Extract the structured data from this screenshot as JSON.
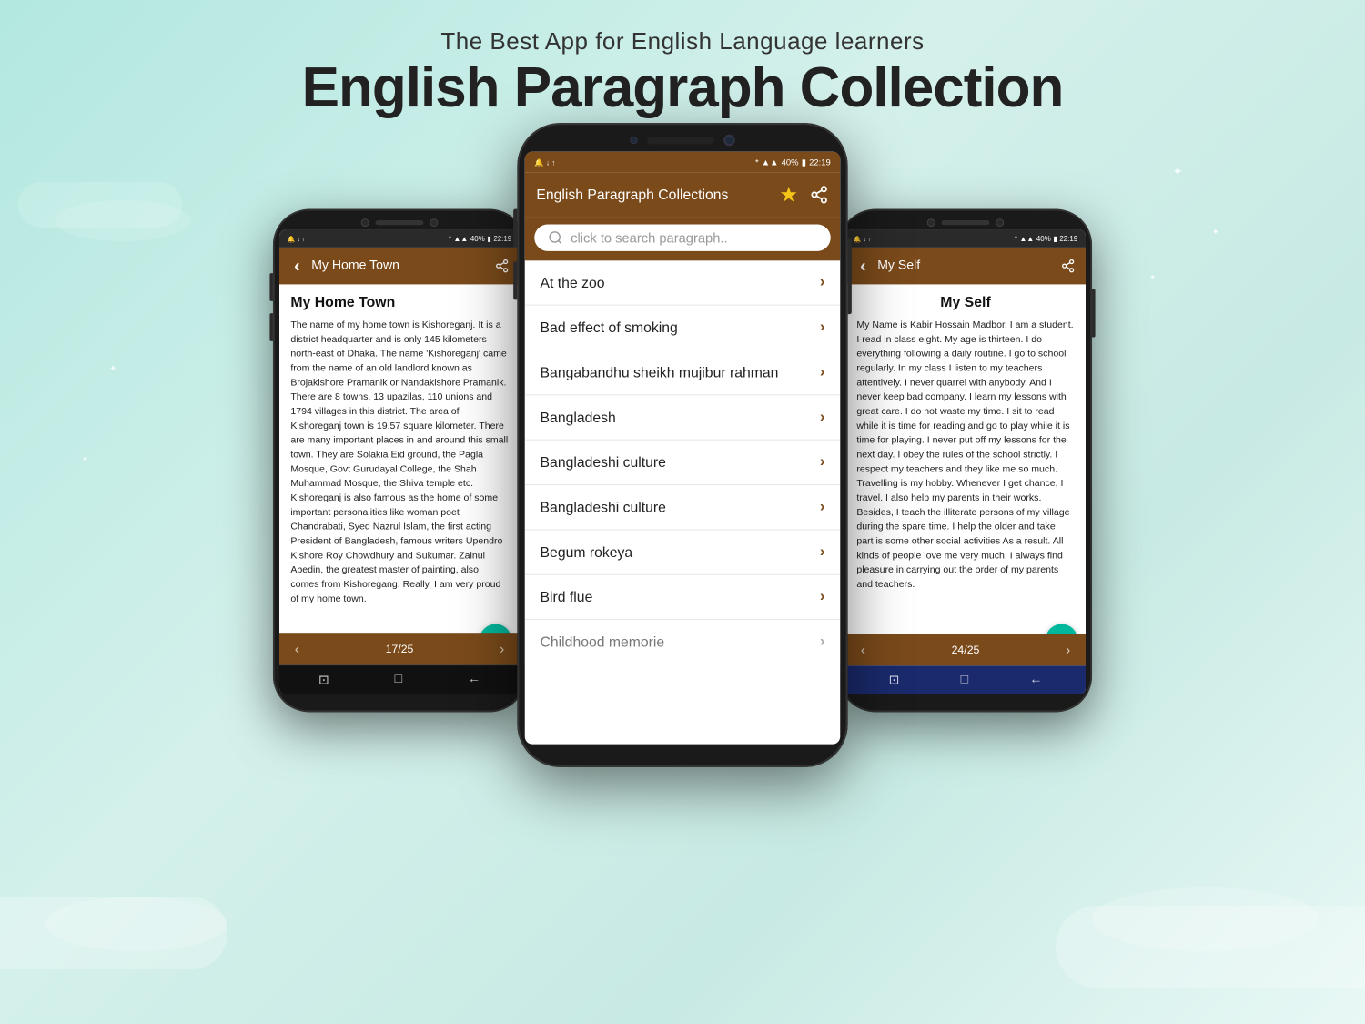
{
  "header": {
    "subtitle": "The Best App for English Language learners",
    "title": "English Paragraph Collection"
  },
  "phones": {
    "left": {
      "title": "My Home Town",
      "article_title": "My Home Town",
      "article_body": "The name of my home town is Kishoreganj. It is a district headquarter and is only 145 kilometers north-east of Dhaka. The name 'Kishoreganj' came from the name of an old landlord known as Brojakishore Pramanik or Nandakishore Pramanik. There are 8 towns, 13 upazilas, 110 unions and 1794 villages in this district. The area of Kishoreganj town is 19.57 square kilometer. There are many important places in and around this small town. They are Solakia Eid ground, the Pagla Mosque, Govt Gurudayal College, the Shah Muhammad Mosque, the Shiva temple etc. Kishoreganj is also famous as the home of some important personalities like woman poet Chandrabati, Syed Nazrul Islam, the first acting President of Bangladesh, famous writers Upendro Kishore Roy Chowdhury and Sukumar. Zainul Abedin, the greatest master of painting, also comes from Kishoregang. Really, I am very proud of my home town.",
      "pagination": "17/25",
      "status_time": "22:19",
      "status_battery": "40%"
    },
    "center": {
      "app_title": "English Paragraph Collections",
      "search_placeholder": "click to search paragraph..",
      "list_items": [
        "At the zoo",
        "Bad effect of smoking",
        "Bangabandhu sheikh mujibur rahman",
        "Bangladesh",
        "Bangladeshi culture",
        "Bangladeshi culture",
        "Begum rokeya",
        "Bird flue",
        "Childhood memorie"
      ],
      "status_time": "22:19",
      "status_battery": "40%"
    },
    "right": {
      "title": "My Self",
      "article_title": "My Self",
      "article_body": "My Name is Kabir Hossain Madbor. I am a student. I read in class eight. My age is thirteen. I do everything following a daily routine. I go to school regularly. In my class I listen to my teachers attentively. I never quarrel with anybody. And I never keep bad company. I learn my lessons with great care. I do not waste my time. I sit to read while it is time for reading and go to play while it is time for playing. I never put off my lessons for the next day. I obey the rules of the school strictly. I respect my teachers and they like me so much. Travelling is my hobby. Whenever I get chance, I travel. I also help my parents in their works. Besides, I teach the illiterate persons of my village during the spare time. I help the older and take part is some other social activities As a result. All kinds of people love me very much. I always find pleasure in carrying out the order of my parents and teachers.",
      "pagination": "24/25",
      "status_time": "22:19",
      "status_battery": "40%"
    }
  },
  "icons": {
    "back": "‹",
    "share": "⋮",
    "star": "★",
    "chevron": "›",
    "search": "🔍",
    "translate": "文A",
    "nav_back": "←",
    "nav_home": "○",
    "nav_recent": "□",
    "nav_menu": "≡",
    "signal": "▲",
    "wifi": "WiFi",
    "battery": "🔋"
  },
  "colors": {
    "header_bg": "#7a4a1a",
    "accent": "#00b89c",
    "blue_nav": "#1a2a6c",
    "star_color": "#f5c518",
    "body_bg_start": "#b2e8e0",
    "body_bg_end": "#e8f8f5"
  }
}
